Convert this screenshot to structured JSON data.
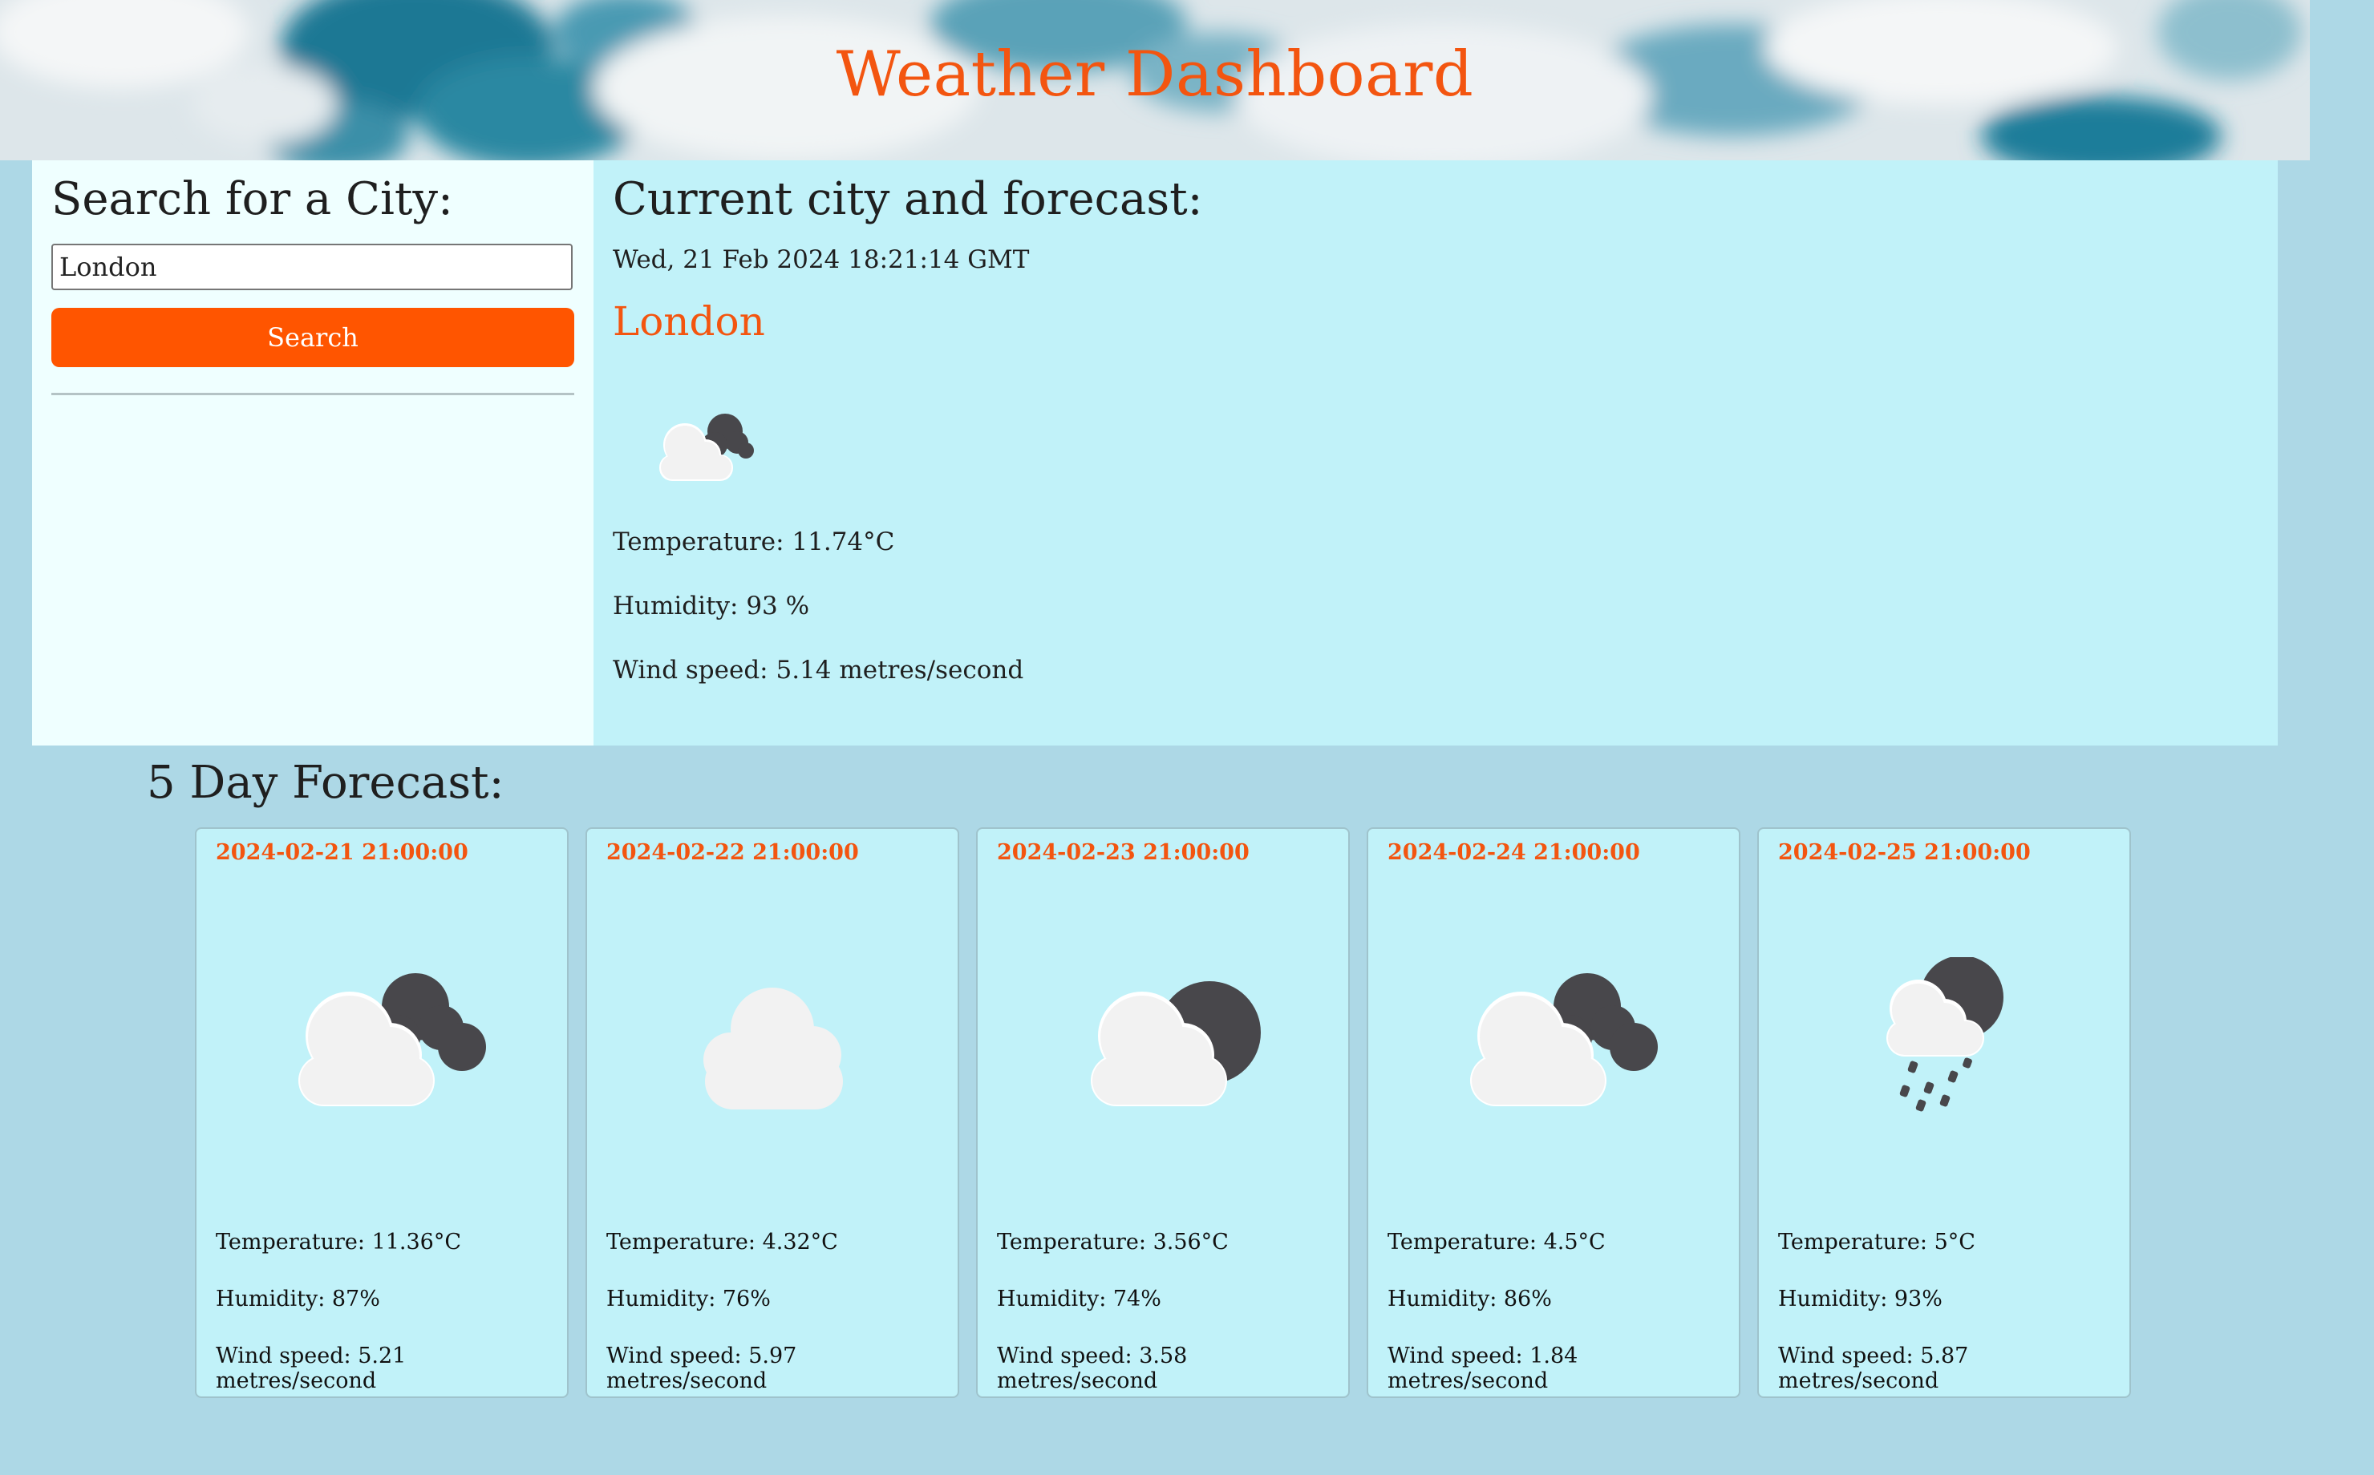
{
  "header": {
    "title": "Weather Dashboard"
  },
  "search": {
    "title": "Search for a City:",
    "input_value": "London",
    "placeholder": "London",
    "button_label": "Search"
  },
  "current": {
    "title": "Current city and forecast:",
    "date": "Wed, 21 Feb 2024 18:21:14 GMT",
    "city": "London",
    "icon": "few-clouds-night-icon",
    "temperature": "Temperature: 11.74°C",
    "humidity": "Humidity: 93 %",
    "wind": "Wind speed: 5.14 metres/second"
  },
  "forecast": {
    "title": "5 Day Forecast:",
    "days": [
      {
        "date": "2024-02-21 21:00:00",
        "icon": "broken-clouds-night-icon",
        "temperature": "Temperature: 11.36°C",
        "humidity": "Humidity: 87%",
        "wind": "Wind speed: 5.21 metres/second"
      },
      {
        "date": "2024-02-22 21:00:00",
        "icon": "cloud-icon",
        "temperature": "Temperature: 4.32°C",
        "humidity": "Humidity: 76%",
        "wind": "Wind speed: 5.97 metres/second"
      },
      {
        "date": "2024-02-23 21:00:00",
        "icon": "partly-cloudy-night-icon",
        "temperature": "Temperature: 3.56°C",
        "humidity": "Humidity: 74%",
        "wind": "Wind speed: 3.58 metres/second"
      },
      {
        "date": "2024-02-24 21:00:00",
        "icon": "broken-clouds-night-icon",
        "temperature": "Temperature: 4.5°C",
        "humidity": "Humidity: 86%",
        "wind": "Wind speed: 1.84 metres/second"
      },
      {
        "date": "2024-02-25 21:00:00",
        "icon": "rain-night-icon",
        "temperature": "Temperature: 5°C",
        "humidity": "Humidity: 93%",
        "wind": "Wind speed: 5.87 metres/second"
      }
    ]
  },
  "colors": {
    "accent": "#f35510",
    "button": "#ff5500",
    "page_background": "#add8e6",
    "panel_background": "#c1f2f9",
    "search_panel_background": "#efffff"
  }
}
